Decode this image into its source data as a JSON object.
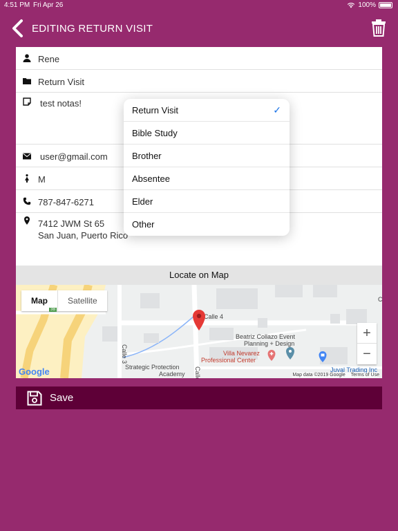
{
  "status_bar": {
    "time": "4:51 PM",
    "date": "Fri Apr 26",
    "battery": "100%"
  },
  "nav": {
    "title": "EDITING RETURN VISIT",
    "back_icon": "chevron-left-icon",
    "delete_icon": "trash-icon"
  },
  "form": {
    "name": "Rene",
    "category": "Return Visit",
    "notes": "test notas!",
    "email": "user@gmail.com",
    "gender": "M",
    "phone": "787-847-6271",
    "address_line1": "7412 JWM St 65",
    "address_line2": "San Juan, Puerto Rico"
  },
  "locate_label": "Locate on Map",
  "map": {
    "tab_map": "Map",
    "tab_satellite": "Satellite",
    "zoom_in": "+",
    "zoom_out": "−",
    "labels": {
      "calle4": "Calle 4",
      "calle3": "Calle 3",
      "calle_partial": "Calle",
      "beatriz_1": "Beatriz Collazo Event",
      "beatriz_2": "Planning + Design",
      "villa_1": "Villa Nevarez",
      "villa_2": "Professional Center",
      "strategic_1": "Strategic Protection",
      "strategic_2": "Academy",
      "juval": "Juval Trading Inc",
      "badge": "3B",
      "edge_c": "C"
    },
    "google": "Google",
    "attribution": "Map data ©2019 Google",
    "terms": "Terms of Use"
  },
  "save_label": "Save",
  "dropdown": {
    "options": [
      "Return Visit",
      "Bible Study",
      "Brother",
      "Absentee",
      "Elder",
      "Other"
    ],
    "selected_index": 0,
    "check": "✓"
  },
  "colors": {
    "background": "#962A6E",
    "save_bar": "#5E0037",
    "check": "#1a73e8"
  }
}
